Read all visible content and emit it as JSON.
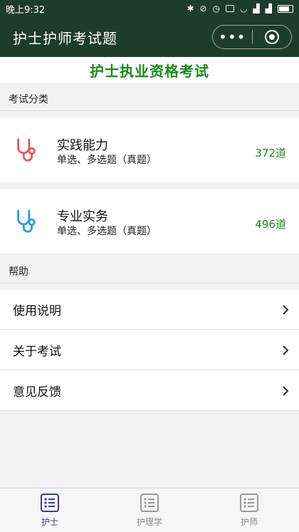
{
  "status_bar": {
    "time": "晚上9:32"
  },
  "nav": {
    "title": "护士护师考试题",
    "more_icon": "•••"
  },
  "banner": {
    "text": "护士执业资格考试"
  },
  "sections": {
    "category_title": "考试分类",
    "help_title": "帮助"
  },
  "categories": [
    {
      "name": "实践能力",
      "sub": "单选、多选题（真题）",
      "count": "372道",
      "icon": "stethoscope-icon",
      "color": "#e65a5a"
    },
    {
      "name": "专业实务",
      "sub": "单选、多选题（真题）",
      "count": "496道",
      "icon": "stethoscope-icon",
      "color": "#2aa0dc"
    }
  ],
  "help_items": [
    {
      "label": "使用说明"
    },
    {
      "label": "关于考试"
    },
    {
      "label": "意见反馈"
    }
  ],
  "tabbar": {
    "items": [
      {
        "label": "护士",
        "active": true
      },
      {
        "label": "护理学",
        "active": false
      },
      {
        "label": "护师",
        "active": false
      }
    ]
  },
  "colors": {
    "nav_bg": "#1e3c2d",
    "accent_green": "#1a8a1a",
    "tab_active": "#3a3aa8"
  }
}
